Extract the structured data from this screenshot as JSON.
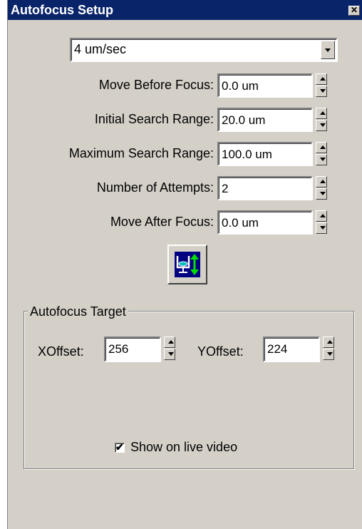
{
  "window": {
    "title": "Autofocus Setup",
    "close_glyph": "✕"
  },
  "speed_combo": {
    "value": "4 um/sec"
  },
  "fields": [
    {
      "label": "Move Before Focus:",
      "value": "0.0 um"
    },
    {
      "label": "Initial Search Range:",
      "value": "20.0 um"
    },
    {
      "label": "Maximum Search Range:",
      "value": "100.0 um"
    },
    {
      "label": "Number of Attempts:",
      "value": "2"
    },
    {
      "label": "Move After Focus:",
      "value": "0.0 um"
    }
  ],
  "autofocus_button": {
    "icon": "autofocus-icon"
  },
  "target_group": {
    "title": "Autofocus Target",
    "xoffset": {
      "label": "XOffset:",
      "value": "256"
    },
    "yoffset": {
      "label": "YOffset:",
      "value": "224"
    },
    "show_live": {
      "label": "Show on live video",
      "checked": true
    }
  },
  "colors": {
    "titlebar": "#0a246a",
    "face": "#d4d0c8",
    "icon_bg": "#000080"
  }
}
